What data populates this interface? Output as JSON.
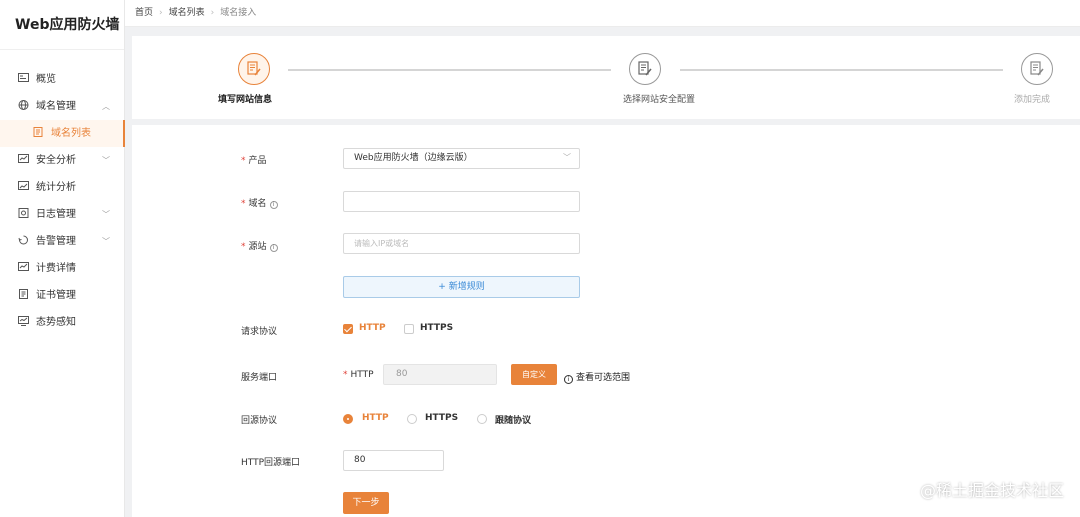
{
  "app": {
    "title": "Web应用防火墙"
  },
  "sidebar": {
    "items": [
      {
        "label": "概览",
        "icon": "overview-icon"
      },
      {
        "label": "域名管理",
        "icon": "globe-icon",
        "expanded": true
      },
      {
        "label": "域名列表",
        "icon": "list-doc-icon",
        "active": true
      },
      {
        "label": "安全分析",
        "icon": "shield-chart-icon"
      },
      {
        "label": "统计分析",
        "icon": "line-chart-icon"
      },
      {
        "label": "日志管理",
        "icon": "log-icon"
      },
      {
        "label": "告警管理",
        "icon": "alarm-icon"
      },
      {
        "label": "计费详情",
        "icon": "billing-icon"
      },
      {
        "label": "证书管理",
        "icon": "certificate-icon"
      },
      {
        "label": "态势感知",
        "icon": "monitor-icon"
      }
    ]
  },
  "breadcrumb": [
    "首页",
    "域名列表",
    "域名接入"
  ],
  "steps": [
    {
      "label": "填写网站信息",
      "state": "active"
    },
    {
      "label": "选择网站安全配置",
      "state": "pending"
    },
    {
      "label": "添加完成",
      "state": "disabled"
    }
  ],
  "form": {
    "product": {
      "label": "产品",
      "value": "Web应用防火墙（边缘云版）"
    },
    "domain": {
      "label": "域名",
      "value": ""
    },
    "origin": {
      "label": "源站",
      "placeholder": "请输入IP或域名"
    },
    "add_rule": "+ 新增规则",
    "protocol": {
      "label": "请求协议",
      "options": [
        "HTTP",
        "HTTPS"
      ],
      "checked": [
        true,
        false
      ]
    },
    "port": {
      "label": "服务端口",
      "prefix": "HTTP",
      "value": "80",
      "custom_button": "自定义",
      "range_link": "查看可选范围"
    },
    "back_protocol": {
      "label": "回源协议",
      "options": [
        "HTTP",
        "HTTPS",
        "跟随协议"
      ],
      "selected": 0
    },
    "back_port": {
      "label": "HTTP回源端口",
      "value": "80"
    },
    "next": "下一步"
  },
  "watermark": "@稀土掘金技术社区",
  "colors": {
    "accent": "#e8833a",
    "link": "#3a8ad6",
    "required": "#e0433a"
  }
}
